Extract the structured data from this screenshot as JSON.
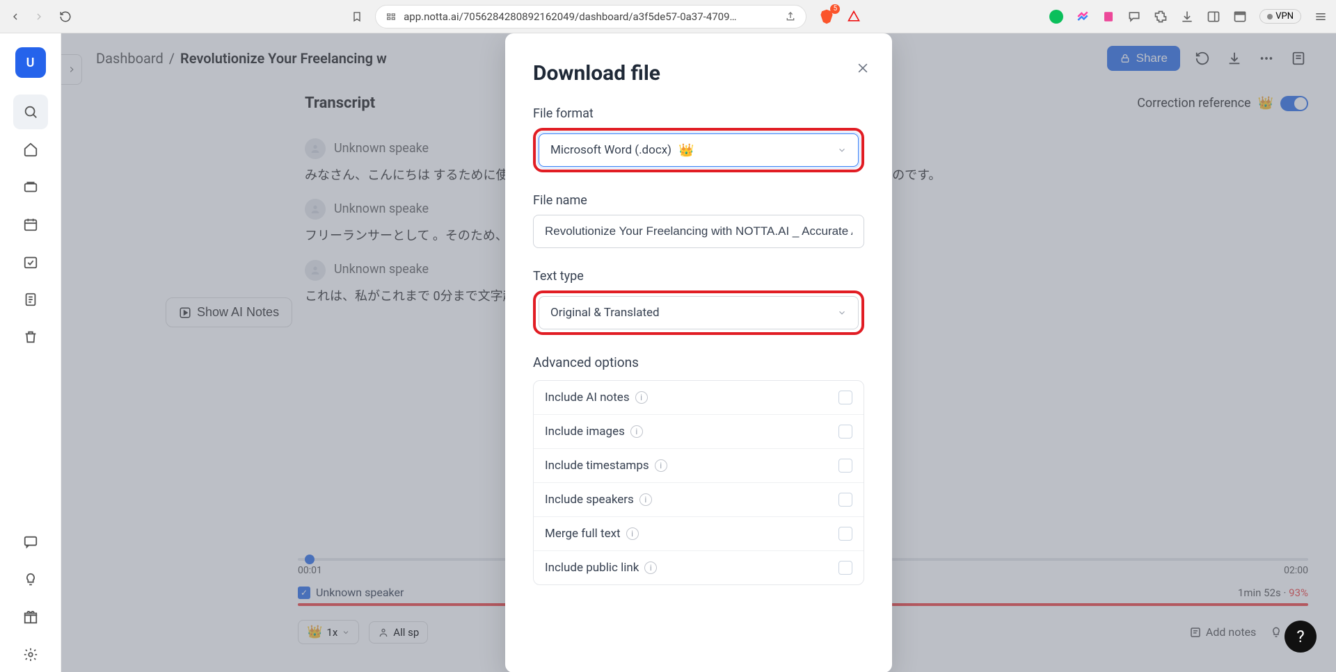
{
  "browser": {
    "url": "app.notta.ai/705628428089216​2049/dashboard/a3f5de57-0a37-4709…",
    "shield_count": "5",
    "vpn_label": "VPN"
  },
  "sidebar": {
    "avatar_letter": "U"
  },
  "breadcrumb": {
    "root": "Dashboard",
    "sep": "/",
    "current": "Revolutionize Your Freelancing w"
  },
  "header": {
    "share": "Share"
  },
  "page": {
    "transcript_title": "Transcript",
    "correction_label": "Correction reference",
    "ai_notes_btn": "Show AI Notes"
  },
  "transcript": {
    "blocks": [
      {
        "speaker": "Unknown speake",
        "text": "みなさん、こんにちは                                                                                                                するために使用できる AI ツールに関する新しいシリ                                                                                                                トに変換する方法に関するものです。"
      },
      {
        "speaker": "Unknown speake",
        "text": "フリーランサーとして                                                                                                           。そのため、音声をテキストに変換する素晴らし                                                                                                            嬉しく思います。"
      },
      {
        "speaker": "Unknown speake",
        "text": "これは、私がこれまで                                                                                                           0分まで文字起こしでき、ほとんどの人にとっては                                                                                                            介します。"
      }
    ]
  },
  "player": {
    "t_start": "00:01",
    "t_end": "02:00",
    "unknown_speaker": "Unknown speaker",
    "stats_time": "1min 52s",
    "stats_sep": " · ",
    "stats_pct": "93%",
    "speed": "1x",
    "all_sp": "All sp",
    "add_notes": "Add notes",
    "tips": "Tips"
  },
  "modal": {
    "title": "Download file",
    "file_format_label": "File format",
    "file_format_value": "Microsoft Word (.docx)",
    "file_name_label": "File name",
    "file_name_value": "Revolutionize Your Freelancing with NOTTA.AI _ Accurate Au",
    "text_type_label": "Text type",
    "text_type_value": "Original & Translated",
    "advanced_label": "Advanced options",
    "options": [
      "Include AI notes",
      "Include images",
      "Include timestamps",
      "Include speakers",
      "Merge full text",
      "Include public link"
    ]
  }
}
